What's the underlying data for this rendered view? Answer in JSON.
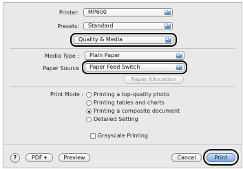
{
  "printer": {
    "label": "Printer:",
    "value": "MP600"
  },
  "presets": {
    "label": "Presets:",
    "value": "Standard"
  },
  "pane": {
    "value": "Quality & Media"
  },
  "media_type": {
    "label": "Media Type :",
    "value": "Plain Paper"
  },
  "paper_source": {
    "label": "Paper Source",
    "value": "Paper Feed Switch"
  },
  "paper_allocation": {
    "label": "Paper Allocation"
  },
  "print_mode": {
    "label": "Print Mode :",
    "options": [
      "Printing a top-quality photo",
      "Printing tables and charts",
      "Printing a composite document",
      "Detailed Setting"
    ],
    "selected_index": 2
  },
  "grayscale": {
    "label": "Grayscale Printing",
    "checked": false
  },
  "footer": {
    "help": "?",
    "pdf": "PDF ▾",
    "preview": "Preview",
    "cancel": "Cancel",
    "print": "Print"
  },
  "arrows_glyph": "▲▼"
}
